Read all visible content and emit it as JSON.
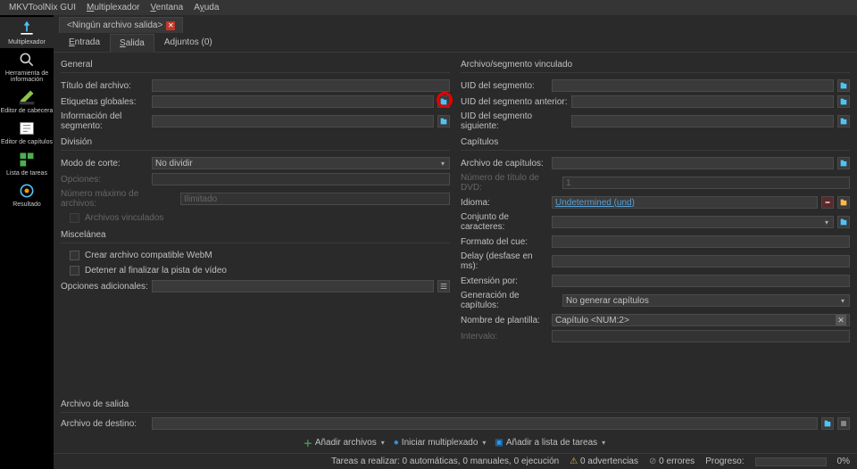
{
  "menubar": {
    "items": [
      "MKVToolNix GUI",
      "Multiplexador",
      "Ventana",
      "Ayuda"
    ]
  },
  "sidebar": {
    "items": [
      {
        "label": "Multiplexador",
        "icon": "mux",
        "active": true
      },
      {
        "label": "Herramienta de\ninformación",
        "icon": "search"
      },
      {
        "label": "Editor de cabecera",
        "icon": "edit"
      },
      {
        "label": "Editor de capítulos",
        "icon": "chapters"
      },
      {
        "label": "Lista de tareas",
        "icon": "tasks"
      },
      {
        "label": "Resultado",
        "icon": "result"
      }
    ]
  },
  "file_tab": {
    "title": "<Ningún archivo salida>"
  },
  "sub_tabs": {
    "entrada": "Entrada",
    "salida": "Salida",
    "adjuntos": "Adjuntos (0)",
    "active": "salida"
  },
  "general": {
    "head": "General",
    "titulo_label": "Título del archivo:",
    "etiquetas_label": "Etiquetas globales:",
    "info_label": "Información del segmento:"
  },
  "division": {
    "head": "División",
    "modo_label": "Modo de corte:",
    "modo_value": "No dividir",
    "opciones_label": "Opciones:",
    "max_label": "Número máximo de archivos:",
    "max_value": "Ilimitado",
    "vinculados_label": "Archivos vinculados"
  },
  "misc": {
    "head": "Miscelánea",
    "webm_label": "Crear archivo compatible WebM",
    "detener_label": "Detener al finalizar la pista de vídeo",
    "adicionales_label": "Opciones adicionales:"
  },
  "vinculo": {
    "head": "Archivo/segmento vinculado",
    "uid_label": "UID del segmento:",
    "uid_ant_label": "UID del segmento anterior:",
    "uid_sig_label": "UID del segmento siguiente:"
  },
  "capitulos": {
    "head": "Capítulos",
    "archivo_label": "Archivo de capítulos:",
    "numero_label": "Número de título de DVD:",
    "numero_value": "1",
    "idioma_label": "Idioma:",
    "idioma_value": "Undetermined (und)",
    "conjunto_label": "Conjunto de caracteres:",
    "formato_label": "Formato del cue:",
    "delay_label": "Delay (desfase en ms):",
    "extension_label": "Extensión por:",
    "generacion_label": "Generación de capítulos:",
    "generacion_value": "No generar capítulos",
    "plantilla_label": "Nombre de plantilla:",
    "plantilla_value": "Capítulo <NUM:2>",
    "intervalo_label": "Intervalo:"
  },
  "output": {
    "head": "Archivo de salida",
    "destino_label": "Archivo de destino:"
  },
  "toolbar": {
    "add_label": "Añadir archivos",
    "start_label": "Iniciar multiplexado",
    "queue_label": "Añadir a lista de tareas"
  },
  "status": {
    "tasks": "Tareas a realizar:  0 automáticas, 0 manuales, 0 ejecución",
    "warnings": "0 advertencias",
    "errors": "0 errores",
    "progress_label": "Progreso:",
    "progress_pct": "0%"
  }
}
